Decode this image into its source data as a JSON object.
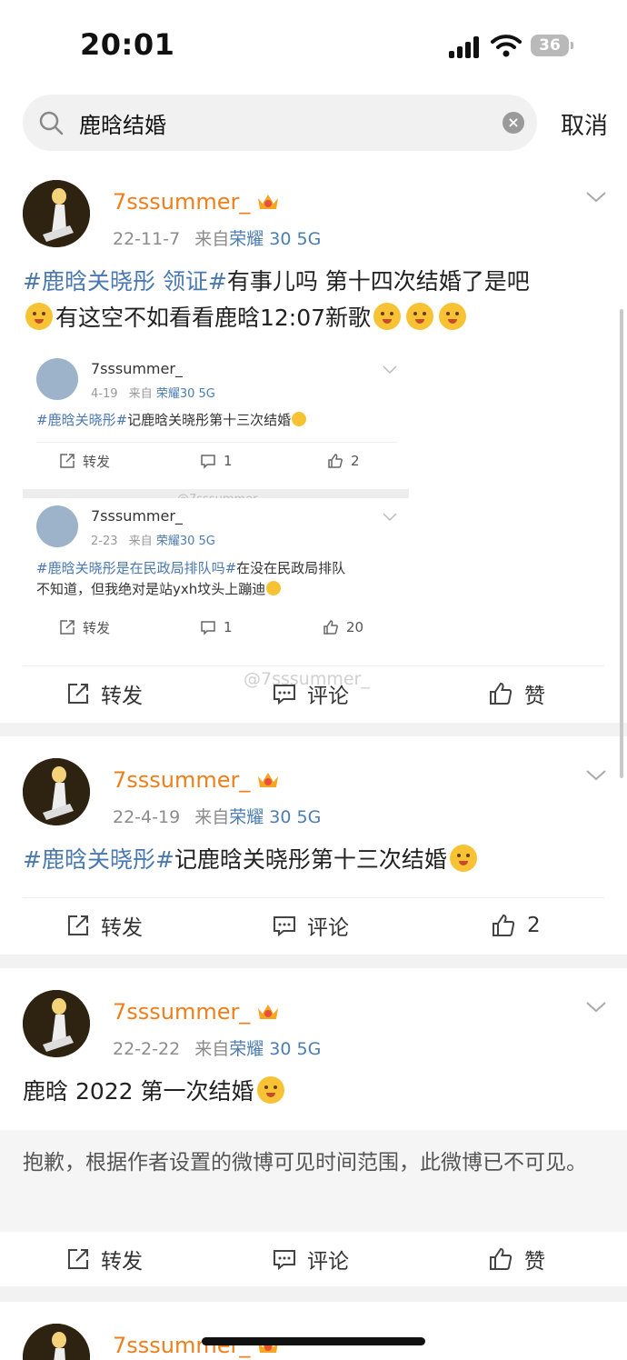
{
  "status_bar": {
    "time": "20:01",
    "battery": "36"
  },
  "search": {
    "query": "鹿晗结婚",
    "cancel_label": "取消"
  },
  "posts": [
    {
      "user": "7sssummer_",
      "date": "22-11-7",
      "source_prefix": "来自",
      "device": "荣耀 30 5G",
      "text_tag": "#鹿晗关晓彤 领证#",
      "text_rest_1": "有事儿吗 第十四次结婚了是吧",
      "text_rest_2": "有这空不如看看鹿晗12:07新歌",
      "embedded": [
        {
          "user": "7sssummer_",
          "date": "4-19",
          "source_prefix": "来自",
          "device": "荣耀30 5G",
          "tag": "#鹿晗关晓彤#",
          "text": "记鹿晗关晓彤第十三次结婚",
          "repost_label": "转发",
          "comment_count": "1",
          "like_count": "2"
        },
        {
          "user": "7sssummer_",
          "date": "2-23",
          "source_prefix": "来自",
          "device": "荣耀30 5G",
          "tag": "#鹿晗关晓彤是在民政局排队吗#",
          "text": "在没在民政局排队",
          "text_line2": "不知道，但我绝对是站yxh坟头上蹦迪",
          "repost_label": "转发",
          "comment_count": "1",
          "like_count": "20"
        }
      ],
      "watermark_small": "@7sssummer_",
      "watermark": "@7sssummer_",
      "repost_label": "转发",
      "comment_label": "评论",
      "like_label": "赞"
    },
    {
      "user": "7sssummer_",
      "date": "22-4-19",
      "source_prefix": "来自",
      "device": "荣耀 30 5G",
      "text_tag": "#鹿晗关晓彤#",
      "text_rest_1": "记鹿晗关晓彤第十三次结婚",
      "repost_label": "转发",
      "comment_label": "评论",
      "like_label": "2"
    },
    {
      "user": "7sssummer_",
      "date": "22-2-22",
      "source_prefix": "来自",
      "device": "荣耀 30 5G",
      "text_rest_1": "鹿晗 2022 第一次结婚",
      "notice": "抱歉，根据作者设置的微博可见时间范围，此微博已不可见。",
      "repost_label": "转发",
      "comment_label": "评论",
      "like_label": "赞"
    },
    {
      "user": "7sssummer_"
    }
  ],
  "colors": {
    "name": "#ef7f1a",
    "tag": "#4a78b0",
    "device": "#4b7db1"
  }
}
